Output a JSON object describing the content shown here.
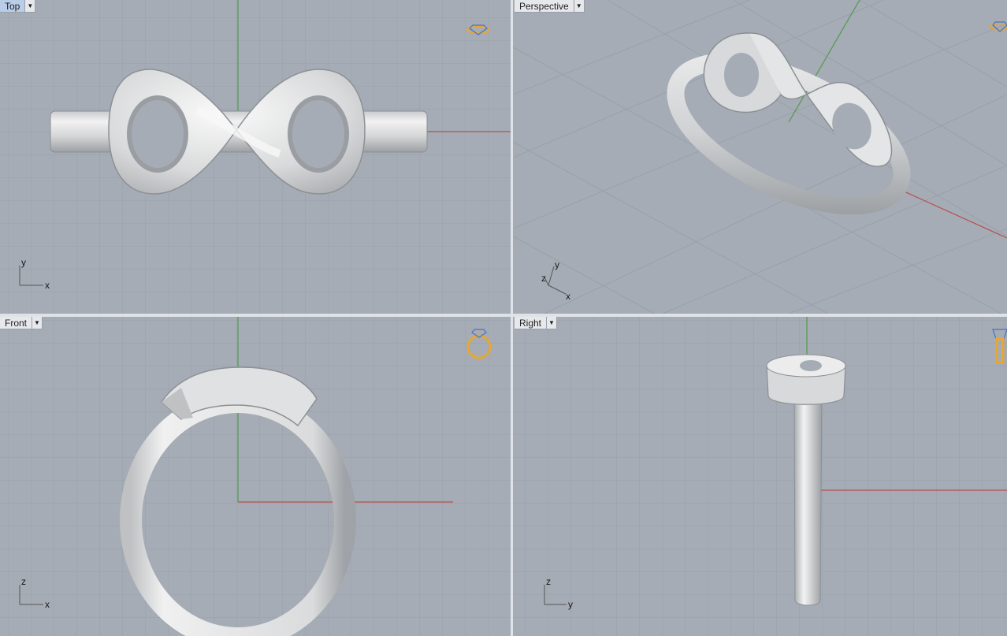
{
  "viewports": {
    "top": {
      "name": "Top",
      "active": true,
      "axes": {
        "h": "x",
        "v": "y"
      }
    },
    "perspective": {
      "name": "Perspective",
      "axes": {
        "h": "x",
        "v": "y",
        "d": "z"
      }
    },
    "front": {
      "name": "Front",
      "axes": {
        "h": "x",
        "v": "z"
      }
    },
    "right": {
      "name": "Right",
      "axes": {
        "h": "y",
        "v": "z"
      }
    }
  },
  "colors": {
    "viewport_bg": "#a5acb5",
    "grid_minor": "#98a0a9",
    "grid_major": "#8d949e",
    "x_axis": "#b8514f",
    "y_axis": "#4e9b4a",
    "gizmo": "#e6a733"
  },
  "icons": {
    "view_gizmo": "ring-gizmo-icon",
    "viewport_menu": "dropdown-arrow-icon"
  }
}
